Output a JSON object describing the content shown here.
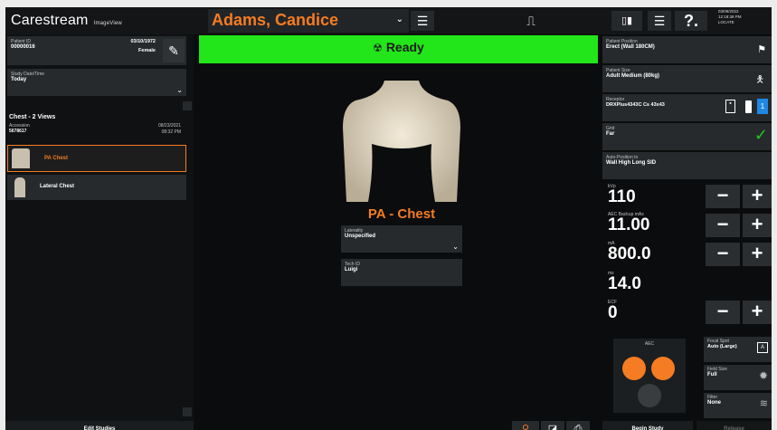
{
  "header": {
    "logo": "Carestream",
    "logo_sub": "ImageView",
    "patient_name": "Adams, Candice",
    "datetime_lines": [
      "03/09/2022",
      "12:18:38 PM",
      "LOCATE"
    ]
  },
  "left_panel": {
    "patient_id_label": "Patient ID",
    "patient_id": "00000016",
    "dob": "03/10/1972",
    "sex": "Female",
    "study_dt_label": "Study Date/Time",
    "study_dt": "Today",
    "study_title": "Chest - 2 Views",
    "accession_label": "Accession",
    "accession": "5678617",
    "study_date": "08/23/2021",
    "study_time": "08:32 PM",
    "views": [
      {
        "label": "PA Chest"
      },
      {
        "label": "Lateral Chest"
      }
    ],
    "edit_studies": "Edit Studies"
  },
  "center": {
    "status": "Ready",
    "view_title": "PA - Chest",
    "laterality_label": "Laterality",
    "laterality": "Unspecified",
    "tech_label": "Tech ID",
    "tech": "Luigi",
    "begin_study": "Begin Study",
    "release": "Release"
  },
  "right_panel": {
    "position_label": "Patient Position",
    "position": "Erect (Wall 180CM)",
    "size_label": "Patient Size",
    "size": "Adult Medium (80kg)",
    "receptor_label": "Receptor",
    "receptor": "DRXPlus4343C Cs 43x43",
    "grid_label": "Grid",
    "grid": "Far",
    "autopos_label": "Auto-Position to",
    "autopos": "Wall High Long SID",
    "kvp_label": "kVp",
    "kvp": "110",
    "aec_label": "AEC Backup mAs",
    "aec": "11.00",
    "ma_label": "mA",
    "ma": "800.0",
    "ms_label": "ms",
    "ms": "14.0",
    "ecf_label": "ECF",
    "ecf": "0",
    "aec_panel_label": "AEC",
    "focal_label": "Focal Spot",
    "focal": "Auto (Large)",
    "field_label": "Field Size",
    "field": "Full",
    "filter_label": "Filter",
    "filter": "None"
  },
  "colors": {
    "accent": "#f57c22",
    "ready": "#22e619",
    "check": "#22c81a"
  }
}
